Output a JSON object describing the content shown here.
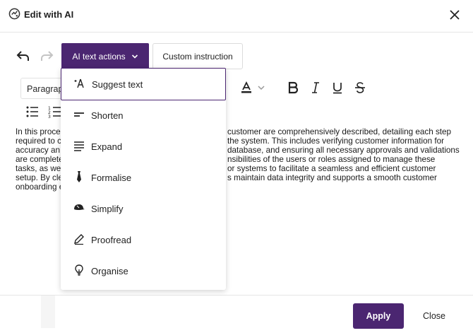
{
  "dialog": {
    "title": "Edit with AI",
    "title_icon": "ai-sparkle-icon",
    "close_icon": "close-icon"
  },
  "toolbar": {
    "undo_icon": "undo-icon",
    "redo_icon": "redo-icon",
    "ai_actions_label": "AI text actions",
    "custom_instruction_label": "Custom instruction",
    "paragraph_label": "Paragraph",
    "format_icons": [
      "font-color-icon",
      "bold-icon",
      "italic-icon",
      "underline-icon",
      "strikethrough-icon"
    ],
    "list_icons": [
      "bullet-list-icon",
      "numbered-list-icon"
    ]
  },
  "ai_menu": {
    "items": [
      {
        "label": "Suggest text",
        "icon": "sparkle-pen-icon",
        "selected": true
      },
      {
        "label": "Shorten",
        "icon": "short-lines-icon"
      },
      {
        "label": "Expand",
        "icon": "long-lines-icon"
      },
      {
        "label": "Formalise",
        "icon": "tie-icon"
      },
      {
        "label": "Simplify",
        "icon": "cap-icon"
      },
      {
        "label": "Proofread",
        "icon": "pencil-icon"
      },
      {
        "label": "Organise",
        "icon": "lightbulb-icon"
      }
    ]
  },
  "editor": {
    "lines": [
      "In this proce",
      "required to c",
      "accuracy an",
      "are complete",
      "tasks, as we",
      "setup. By cle",
      "onboarding e"
    ],
    "lines_right": [
      "customer are comprehensively described, detailing each step",
      "the system. This includes verifying customer information for",
      "database, and ensuring all necessary approvals and validations",
      "nsibilities of the users or roles assigned to manage these",
      "or systems to facilitate a seamless and efficient customer",
      "s maintain data integrity and supports a smooth customer",
      ""
    ]
  },
  "footer": {
    "apply_label": "Apply",
    "close_label": "Close"
  },
  "colors": {
    "accent": "#4b2671",
    "border": "#e6e6e6"
  }
}
